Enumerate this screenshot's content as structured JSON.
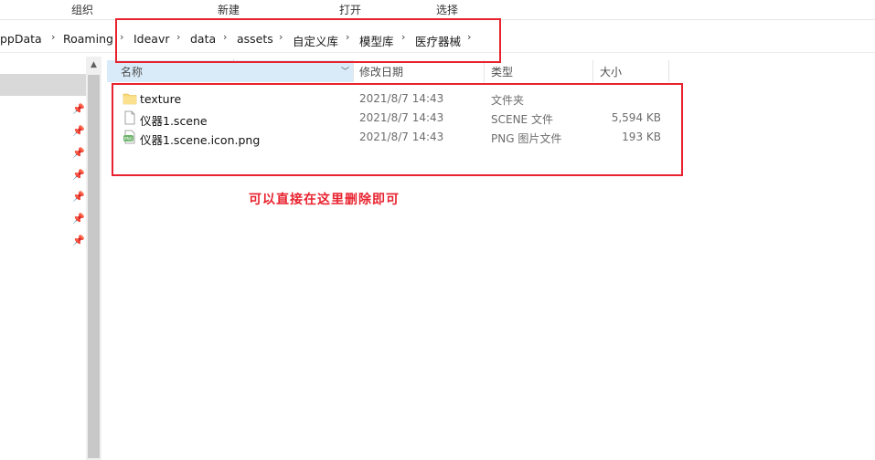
{
  "ribbon": {
    "groups": [
      {
        "id": "organize",
        "label": "组织"
      },
      {
        "id": "new",
        "label": "新建"
      },
      {
        "id": "open",
        "label": "打开"
      },
      {
        "id": "select",
        "label": "选择"
      }
    ]
  },
  "address": {
    "crumbs": [
      "ppData",
      "Roaming",
      "Ideavr",
      "data",
      "assets",
      "自定义库",
      "模型库",
      "医疗器械"
    ]
  },
  "columns": {
    "name": "名称",
    "date": "修改日期",
    "type": "类型",
    "size": "大小"
  },
  "files": [
    {
      "icon": "folder-icon",
      "name": "texture",
      "date": "2021/8/7 14:43",
      "type": "文件夹",
      "size": ""
    },
    {
      "icon": "document-icon",
      "name": "仪器1.scene",
      "date": "2021/8/7 14:43",
      "type": "SCENE 文件",
      "size": "5,594 KB"
    },
    {
      "icon": "png-image-icon",
      "name": "仪器1.scene.icon.png",
      "date": "2021/8/7 14:43",
      "type": "PNG 图片文件",
      "size": "193 KB"
    }
  ],
  "annotation": {
    "text": "可以直接在这里删除即可",
    "color": "#e8232f"
  },
  "colors": {
    "header_selected": "#d9ebf9",
    "nav_selected": "#d9d9d9"
  }
}
